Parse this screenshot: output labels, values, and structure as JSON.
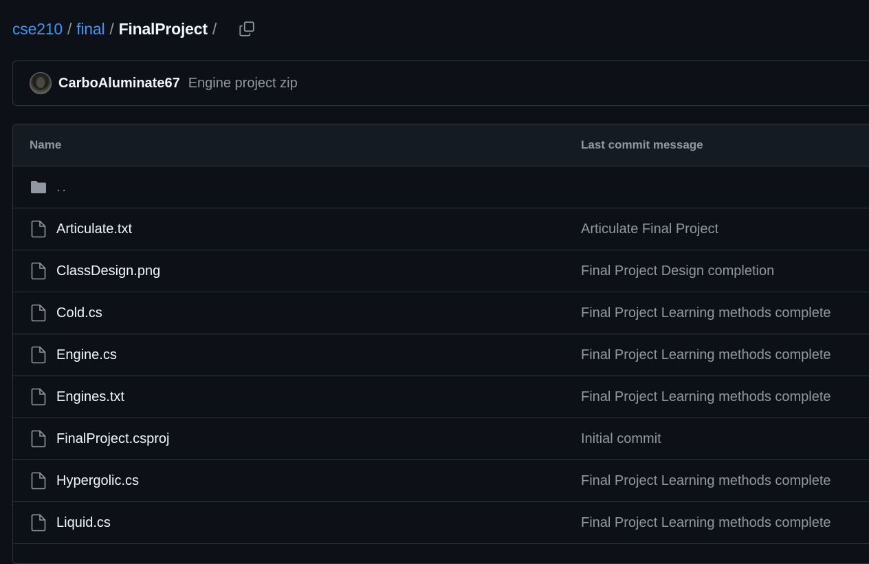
{
  "breadcrumb": {
    "repo": "cse210",
    "folder": "final",
    "current": "FinalProject",
    "separator": "/",
    "copy_icon": "copy-icon"
  },
  "latest_commit": {
    "author": "CarboAluminate67",
    "message": "Engine project zip",
    "avatar_icon": "avatar"
  },
  "table": {
    "headers": {
      "name": "Name",
      "last_commit": "Last commit message"
    },
    "parent_dir": {
      "label": "..",
      "icon": "folder-icon"
    },
    "files": [
      {
        "name": "Articulate.txt",
        "message": "Articulate Final Project",
        "icon": "file-icon"
      },
      {
        "name": "ClassDesign.png",
        "message": "Final Project Design completion",
        "icon": "file-icon"
      },
      {
        "name": "Cold.cs",
        "message": "Final Project Learning methods complete",
        "icon": "file-icon"
      },
      {
        "name": "Engine.cs",
        "message": "Final Project Learning methods complete",
        "icon": "file-icon"
      },
      {
        "name": "Engines.txt",
        "message": "Final Project Learning methods complete",
        "icon": "file-icon"
      },
      {
        "name": "FinalProject.csproj",
        "message": "Initial commit",
        "icon": "file-icon"
      },
      {
        "name": "Hypergolic.cs",
        "message": "Final Project Learning methods complete",
        "icon": "file-icon"
      },
      {
        "name": "Liquid.cs",
        "message": "Final Project Learning methods complete",
        "icon": "file-icon"
      }
    ]
  },
  "colors": {
    "background": "#0d1117",
    "link": "#4493f8",
    "border": "#30363d",
    "muted_text": "#9198a1",
    "header_bg": "#151b23"
  }
}
